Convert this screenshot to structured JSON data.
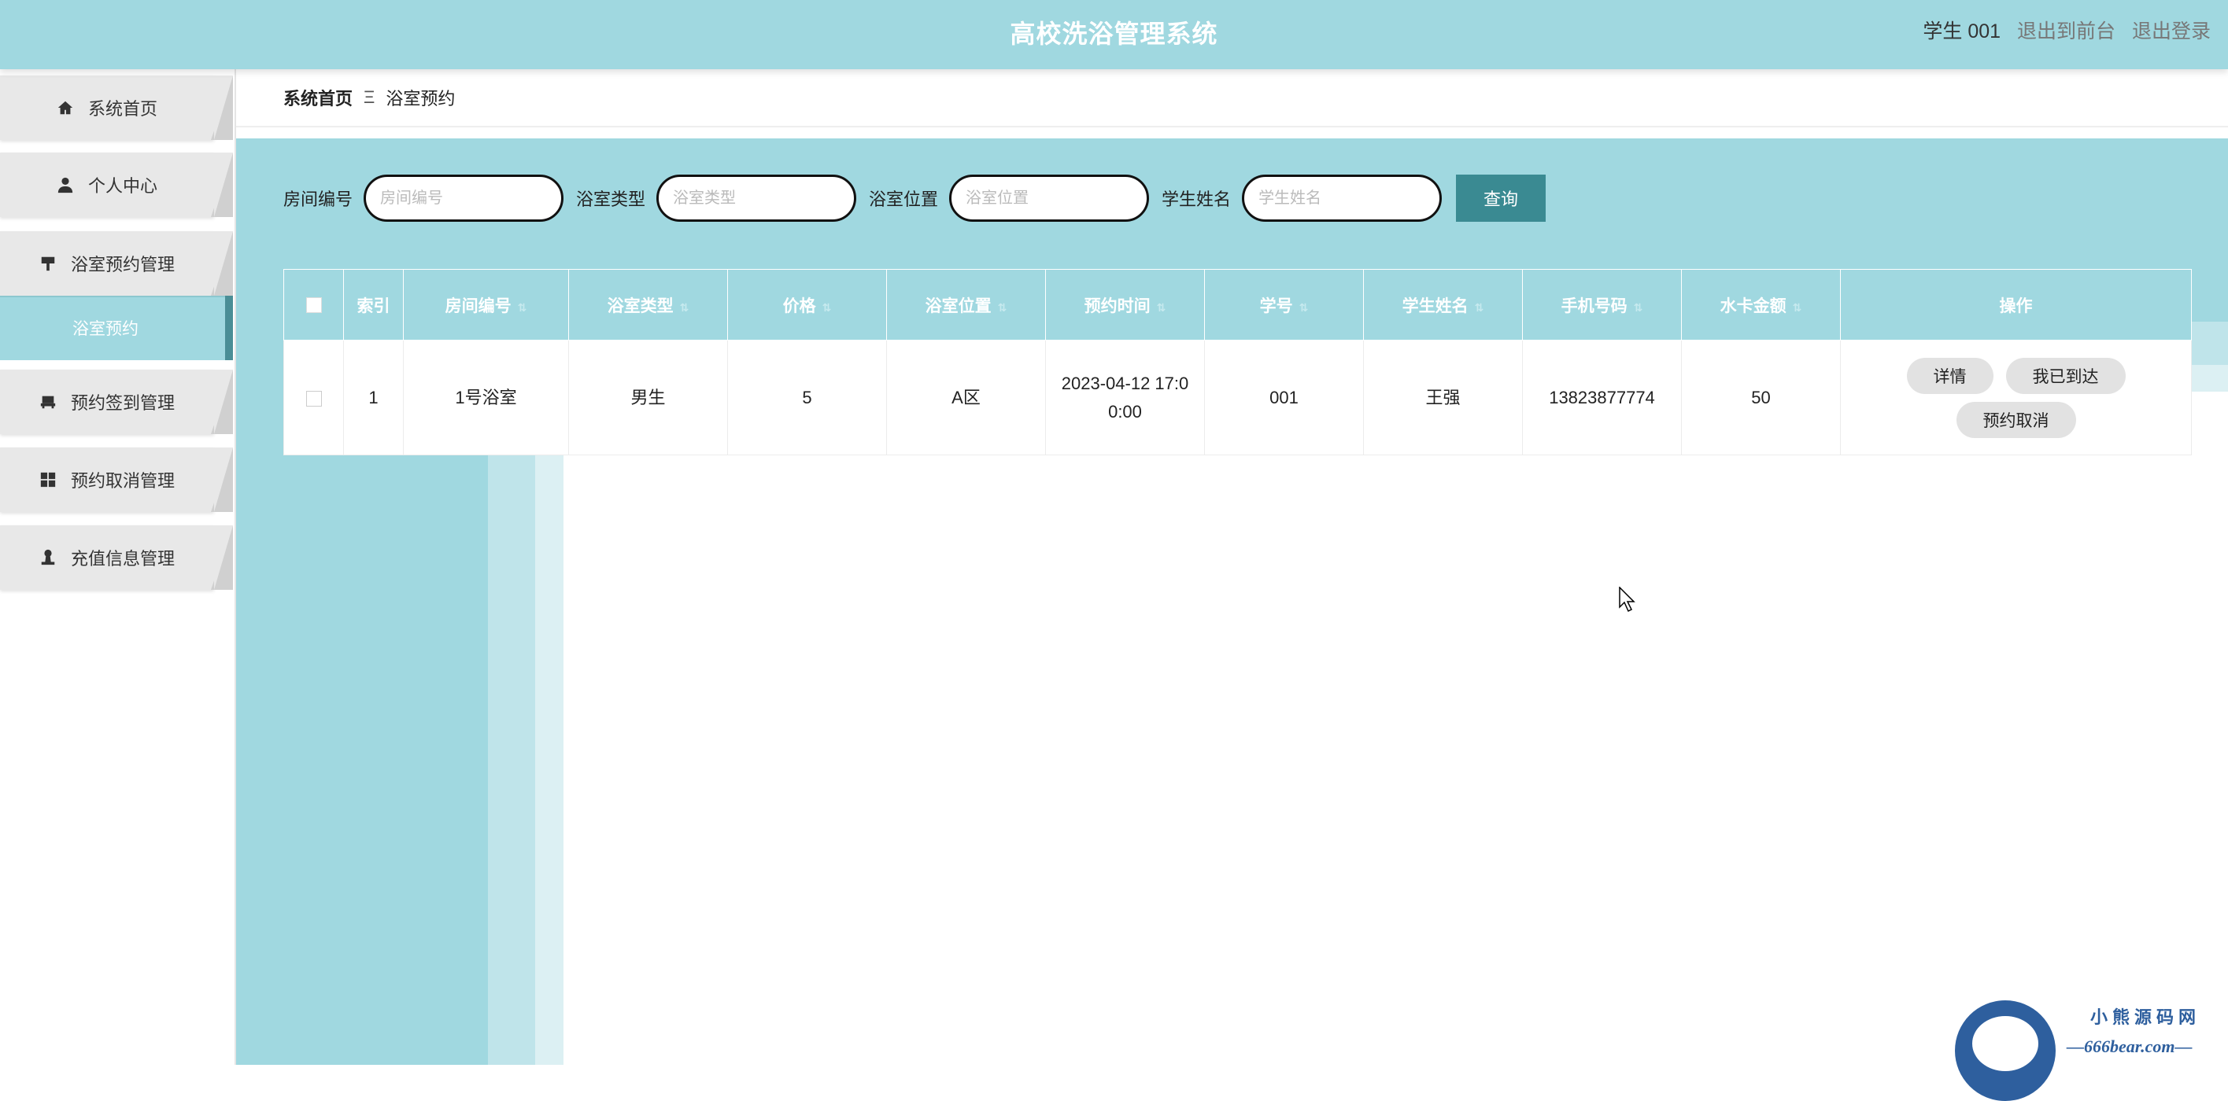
{
  "header": {
    "title": "高校洗浴管理系统",
    "user": "学生 001",
    "to_front": "退出到前台",
    "logout": "退出登录"
  },
  "sidebar": {
    "items": [
      {
        "label": "系统首页",
        "icon": "home-icon"
      },
      {
        "label": "个人中心",
        "icon": "person-icon"
      },
      {
        "label": "浴室预约管理",
        "icon": "brush-icon"
      },
      {
        "label": "预约签到管理",
        "icon": "chair-icon"
      },
      {
        "label": "预约取消管理",
        "icon": "grid-icon"
      },
      {
        "label": "充值信息管理",
        "icon": "person-stamp-icon"
      }
    ],
    "sub_active": "浴室预约"
  },
  "breadcrumb": {
    "home": "系统首页",
    "separator": "Ξ",
    "current": "浴室预约"
  },
  "search": {
    "fields": [
      {
        "label": "房间编号",
        "placeholder": "房间编号"
      },
      {
        "label": "浴室类型",
        "placeholder": "浴室类型"
      },
      {
        "label": "浴室位置",
        "placeholder": "浴室位置"
      },
      {
        "label": "学生姓名",
        "placeholder": "学生姓名"
      }
    ],
    "button": "查询"
  },
  "table": {
    "columns": [
      "索引",
      "房间编号",
      "浴室类型",
      "价格",
      "浴室位置",
      "预约时间",
      "学号",
      "学生姓名",
      "手机号码",
      "水卡金额",
      "操作"
    ],
    "rows": [
      {
        "index": "1",
        "room": "1号浴室",
        "type": "男生",
        "price": "5",
        "location": "A区",
        "time": "2023-04-12 17:00:00",
        "student_id": "001",
        "name": "王强",
        "phone": "13823877774",
        "balance": "50"
      }
    ],
    "actions": [
      "详情",
      "我已到达",
      "预约取消"
    ]
  },
  "watermark": {
    "line1": "小熊源码网",
    "line2": "—666bear.com—"
  },
  "colors": {
    "accent": "#a0d8e0",
    "button": "#3a8a92",
    "active_border": "#4a8e96"
  }
}
